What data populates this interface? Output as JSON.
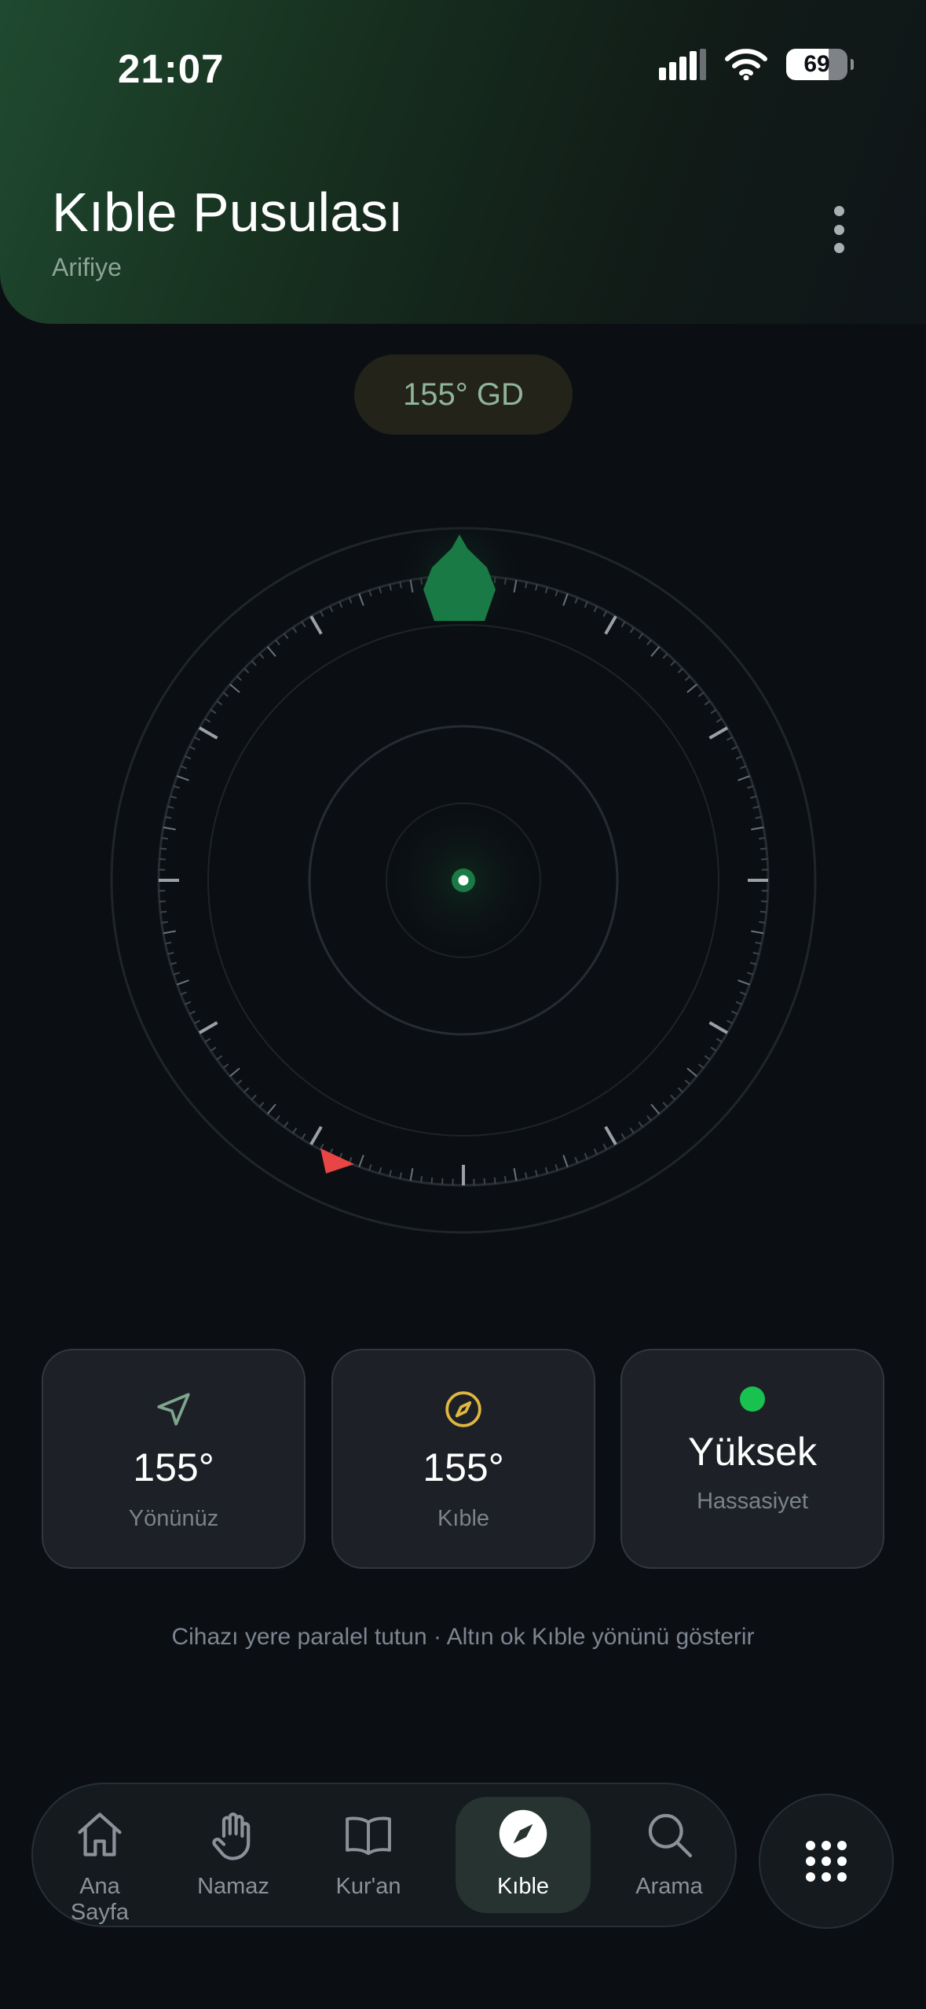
{
  "status_bar": {
    "time": "21:07",
    "battery": "69"
  },
  "header": {
    "title": "Kıble Pusulası",
    "location": "Arifiye"
  },
  "heading_pill": "155° GD",
  "cards": [
    {
      "icon": "navigation-arrow-icon",
      "value": "155°",
      "label": "Yönünüz"
    },
    {
      "icon": "compass-icon",
      "value": "155°",
      "label": "Kıble"
    },
    {
      "icon": "status-dot-icon",
      "value": "Yüksek",
      "label": "Hassasiyet"
    }
  ],
  "hint": "Cihazı yere paralel tutun · Altın ok Kıble yönünü gösterir",
  "nav": {
    "items": [
      {
        "label": "Ana Sayfa",
        "icon": "home-icon"
      },
      {
        "label": "Namaz",
        "icon": "hand-icon"
      },
      {
        "label": "Kur'an",
        "icon": "book-icon"
      },
      {
        "label": "Kıble",
        "icon": "compass-icon",
        "active": true
      },
      {
        "label": "Arama",
        "icon": "search-icon"
      }
    ],
    "more_icon": "grid-icon"
  },
  "colors": {
    "background": "#0b0f14",
    "accent_green": "#1a7a45",
    "north_marker": "#e84545",
    "kaaba_gold": "#e0b73f"
  }
}
